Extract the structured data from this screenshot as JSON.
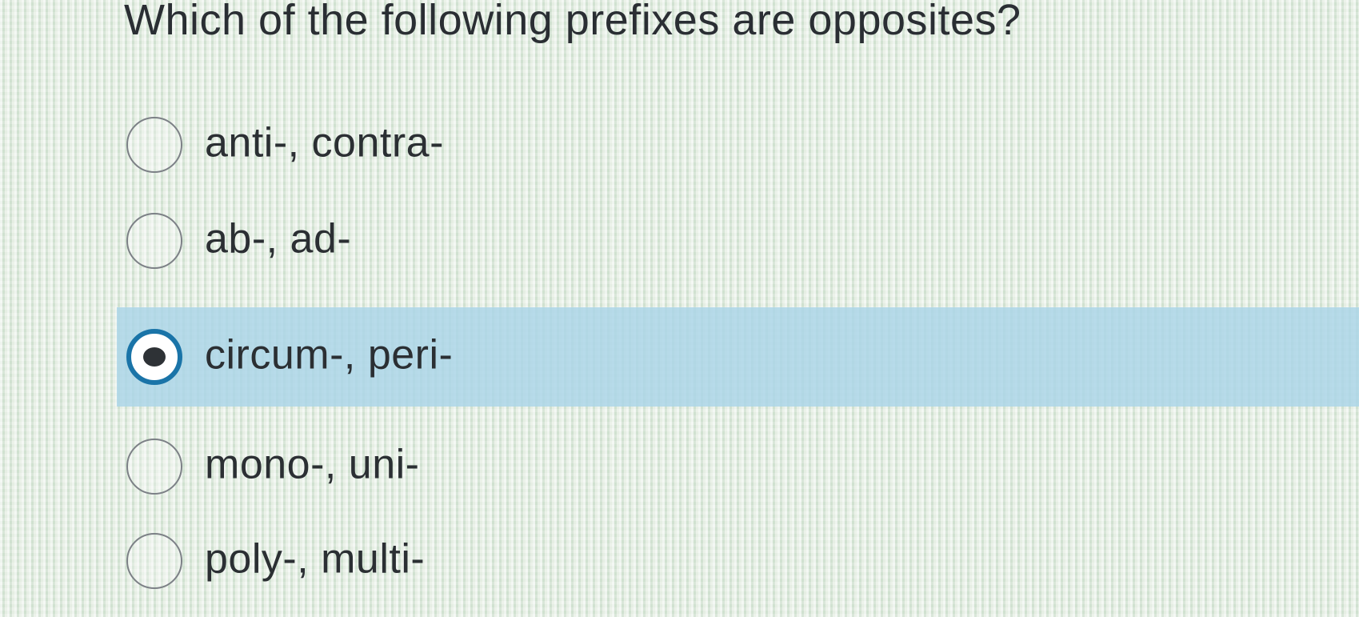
{
  "question": {
    "title": "Which of the following prefixes are opposites?"
  },
  "options": [
    {
      "label": "anti-, contra-",
      "selected": false
    },
    {
      "label": "ab-, ad-",
      "selected": false
    },
    {
      "label": "circum-, peri-",
      "selected": true
    },
    {
      "label": "mono-, uni-",
      "selected": false
    },
    {
      "label": "poly-, multi-",
      "selected": false
    }
  ],
  "colors": {
    "selected_highlight": "#aad4e8",
    "radio_checked_ring": "#1a74a8",
    "text": "#2b2f33"
  }
}
